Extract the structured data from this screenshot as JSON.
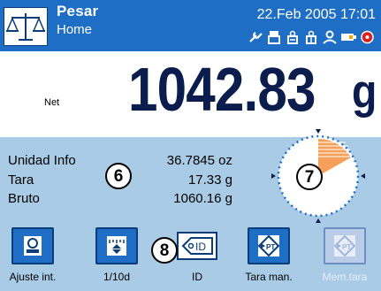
{
  "header": {
    "title": "Pesar",
    "subtitle": "Home",
    "datetime": "22.Feb 2005  17:01",
    "status_icons": [
      "wrench-icon",
      "printer-icon",
      "calibration-icon",
      "calibration-check-icon",
      "user-icon",
      "battery-icon",
      "alarm-icon"
    ]
  },
  "weight": {
    "net_label": "Net",
    "value": "1042.83",
    "unit": "g"
  },
  "info": {
    "rows": [
      {
        "label": "Unidad Info",
        "value": "36.7845 oz"
      },
      {
        "label": "Tara",
        "value": "17.33 g"
      },
      {
        "label": "Bruto",
        "value": "1060.16 g"
      }
    ],
    "callouts": [
      "6",
      "7",
      "8"
    ]
  },
  "softkeys": [
    {
      "label": "Ajuste int.",
      "icon": "balance-calibration-icon",
      "enabled": true
    },
    {
      "label": "1/10d",
      "icon": "resolution-icon",
      "enabled": true
    },
    {
      "label": "ID",
      "icon": "id-tag-icon",
      "enabled": true
    },
    {
      "label": "Tara man.",
      "icon": "manual-tare-icon",
      "enabled": true
    },
    {
      "label": "Mem.tara",
      "icon": "tare-memory-icon",
      "enabled": false
    }
  ],
  "colors": {
    "header_bg": "#1e6ec6",
    "info_bg": "#a9cbe6",
    "weight_text": "#0b1d4d",
    "dial_fill": "#f5a05a"
  }
}
